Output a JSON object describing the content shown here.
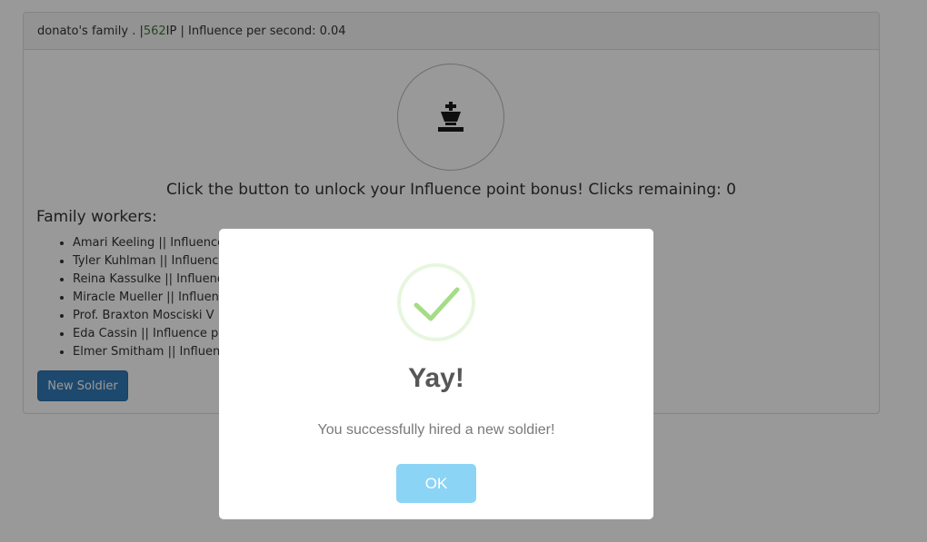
{
  "header": {
    "family_name": "donato's family . | ",
    "ip_value": "562",
    "ip_suffix": " IP | Influence per second: 0.04"
  },
  "bonus": {
    "icon": "chess-king-icon",
    "text": "Click the button to unlock your Influence point bonus! Clicks remaining: 0"
  },
  "workers": {
    "title": "Family workers:",
    "items": [
      "Amari Keeling || Influence",
      "Tyler Kuhlman || Influence",
      "Reina Kassulke || Influence",
      "Miracle Mueller || Influenc",
      "Prof. Braxton Mosciski V ||",
      "Eda Cassin || Influence per",
      "Elmer Smitham || Influence"
    ]
  },
  "new_soldier_label": "New Soldier",
  "modal": {
    "icon": "success-check-icon",
    "title": "Yay!",
    "text": "You successfully hired a new soldier!",
    "ok_label": "OK"
  },
  "colors": {
    "ip_green": "#3c763d",
    "primary": "#337ab7",
    "ok_button": "#8cd4f5",
    "success_check": "#a5dc86"
  }
}
